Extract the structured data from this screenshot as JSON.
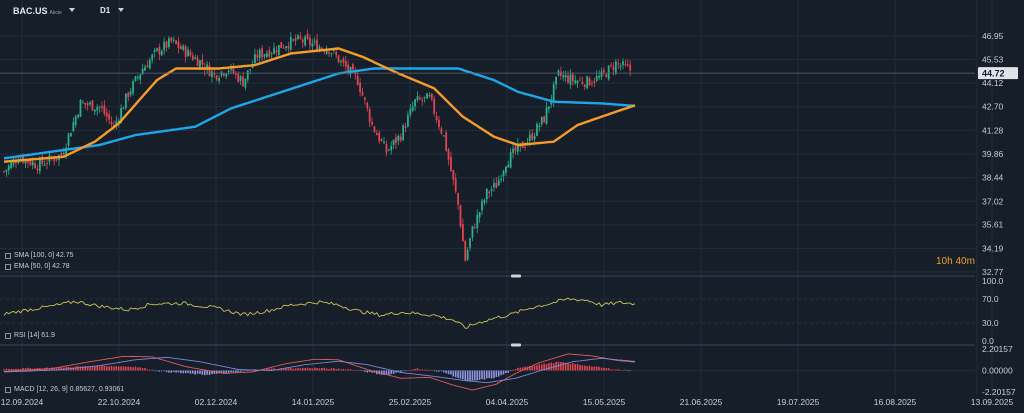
{
  "header": {
    "symbol": "BAC.US",
    "symbol_sub": "Akcie",
    "timeframe": "D1"
  },
  "timer": "10h 40m",
  "legends": {
    "sma": "SMA [100, 0] 42.75",
    "ema": "EMA [50, 0] 42.78",
    "rsi": "RSI [14] 61.9",
    "macd": "MACD [12, 26, 9] 0.85627, 0.93061"
  },
  "colors": {
    "bg": "#161e2a",
    "up": "#27b08a",
    "down": "#e0444f",
    "sma": "#1ea6e8",
    "ema": "#f39c2a",
    "rsi": "#c8c25a",
    "macd_line": "#e35b5b",
    "signal_line": "#7a86d6",
    "hist_pos": "#e0444f",
    "hist_neg": "#8f96e0",
    "grid": "#222c3a",
    "text": "#c8ced8",
    "price_tag_bg": "#dfe3ea"
  },
  "chart_data": [
    {
      "type": "line",
      "name": "price",
      "x_ticks": [
        "12.09.2024",
        "22.10.2024",
        "02.12.2024",
        "14.01.2025",
        "25.02.2025",
        "04.04.2025",
        "15.05.2025",
        "21.06.2025",
        "19.07.2025",
        "16.08.2025",
        "13.09.2025"
      ],
      "y_ticks": [
        "46.95",
        "45.53",
        "44.12",
        "42.70",
        "41.28",
        "39.86",
        "38.44",
        "37.02",
        "35.61",
        "34.19",
        "32.77"
      ],
      "ylim": [
        32.77,
        46.95
      ],
      "current_price": "44.72",
      "current_value": 44.72,
      "candles_approx": {
        "start": "12.09.2024",
        "end": "13.06.2025",
        "anchors": [
          [
            0,
            38.8
          ],
          [
            6,
            39.7
          ],
          [
            14,
            39.2
          ],
          [
            24,
            39.8
          ],
          [
            32,
            42.9
          ],
          [
            40,
            42.7
          ],
          [
            46,
            41.5
          ],
          [
            52,
            43.5
          ],
          [
            58,
            45.0
          ],
          [
            64,
            46.0
          ],
          [
            70,
            46.6
          ],
          [
            76,
            46.0
          ],
          [
            82,
            45.4
          ],
          [
            88,
            44.6
          ],
          [
            94,
            45.0
          ],
          [
            100,
            44.2
          ],
          [
            106,
            45.8
          ],
          [
            112,
            46.1
          ],
          [
            118,
            46.5
          ],
          [
            124,
            46.7
          ],
          [
            130,
            46.4
          ],
          [
            136,
            46.2
          ],
          [
            142,
            45.2
          ],
          [
            148,
            44.3
          ],
          [
            154,
            41.6
          ],
          [
            160,
            40.0
          ],
          [
            166,
            41.0
          ],
          [
            172,
            43.0
          ],
          [
            178,
            43.2
          ],
          [
            184,
            40.9
          ],
          [
            190,
            36.8
          ],
          [
            193,
            33.5
          ],
          [
            196,
            35.3
          ],
          [
            202,
            37.5
          ],
          [
            206,
            38.0
          ],
          [
            210,
            39.4
          ],
          [
            214,
            40.0
          ],
          [
            220,
            40.8
          ],
          [
            226,
            42.0
          ],
          [
            232,
            44.6
          ],
          [
            238,
            44.3
          ],
          [
            244,
            44.2
          ],
          [
            250,
            44.5
          ],
          [
            256,
            45.3
          ],
          [
            262,
            44.9
          ]
        ]
      },
      "series": [
        {
          "name": "SMA [100, 0]",
          "color": "#1ea6e8",
          "points": [
            [
              0,
              39.6
            ],
            [
              40,
              40.4
            ],
            [
              55,
              41.0
            ],
            [
              80,
              41.5
            ],
            [
              95,
              42.6
            ],
            [
              110,
              43.3
            ],
            [
              125,
              44.0
            ],
            [
              140,
              44.7
            ],
            [
              155,
              45.0
            ],
            [
              175,
              45.0
            ],
            [
              190,
              45.0
            ],
            [
              205,
              44.3
            ],
            [
              215,
              43.6
            ],
            [
              230,
              43.0
            ],
            [
              250,
              42.9
            ],
            [
              264,
              42.75
            ]
          ]
        },
        {
          "name": "EMA [50, 0]",
          "color": "#f39c2a",
          "points": [
            [
              0,
              39.4
            ],
            [
              25,
              39.7
            ],
            [
              38,
              40.6
            ],
            [
              48,
              41.7
            ],
            [
              56,
              43.0
            ],
            [
              64,
              44.3
            ],
            [
              72,
              45.0
            ],
            [
              90,
              45.0
            ],
            [
              105,
              45.2
            ],
            [
              120,
              45.9
            ],
            [
              140,
              46.2
            ],
            [
              150,
              45.7
            ],
            [
              165,
              44.7
            ],
            [
              180,
              43.8
            ],
            [
              192,
              42.1
            ],
            [
              205,
              40.9
            ],
            [
              215,
              40.4
            ],
            [
              230,
              40.6
            ],
            [
              240,
              41.6
            ],
            [
              252,
              42.2
            ],
            [
              264,
              42.78
            ]
          ]
        }
      ]
    },
    {
      "type": "line",
      "name": "rsi",
      "y_ticks": [
        "100.0",
        "70.0",
        "30.0",
        "0.0"
      ],
      "ylim": [
        0,
        100
      ],
      "series": [
        {
          "name": "RSI [14]",
          "color": "#c8c25a",
          "points": [
            [
              0,
              45
            ],
            [
              10,
              52
            ],
            [
              20,
              58
            ],
            [
              30,
              66
            ],
            [
              40,
              58
            ],
            [
              52,
              52
            ],
            [
              62,
              62
            ],
            [
              75,
              63
            ],
            [
              90,
              54
            ],
            [
              100,
              44
            ],
            [
              110,
              50
            ],
            [
              120,
              60
            ],
            [
              132,
              65
            ],
            [
              140,
              60
            ],
            [
              148,
              50
            ],
            [
              158,
              43
            ],
            [
              166,
              48
            ],
            [
              172,
              46
            ],
            [
              180,
              43
            ],
            [
              188,
              35
            ],
            [
              193,
              22
            ],
            [
              198,
              30
            ],
            [
              205,
              38
            ],
            [
              212,
              44
            ],
            [
              220,
              55
            ],
            [
              228,
              62
            ],
            [
              236,
              70
            ],
            [
              244,
              68
            ],
            [
              250,
              60
            ],
            [
              258,
              64
            ],
            [
              264,
              61.9
            ]
          ]
        }
      ]
    },
    {
      "type": "bar",
      "name": "macd",
      "y_ticks": [
        "2.20157",
        "0.00000",
        "-2.20157"
      ],
      "ylim": [
        -2.20157,
        2.20157
      ],
      "hist_anchors": [
        [
          0,
          0.3
        ],
        [
          20,
          0.5
        ],
        [
          40,
          0.9
        ],
        [
          55,
          0.7
        ],
        [
          66,
          -0.2
        ],
        [
          84,
          -0.8
        ],
        [
          96,
          -0.4
        ],
        [
          110,
          0.3
        ],
        [
          128,
          0.5
        ],
        [
          146,
          0.2
        ],
        [
          160,
          -0.9
        ],
        [
          172,
          0.4
        ],
        [
          184,
          -0.3
        ],
        [
          194,
          -2.1
        ],
        [
          206,
          -1.3
        ],
        [
          216,
          0.6
        ],
        [
          232,
          1.6
        ],
        [
          244,
          0.9
        ],
        [
          254,
          0.3
        ],
        [
          264,
          -0.08
        ]
      ],
      "series": [
        {
          "name": "MACD [12, 26, 9]",
          "color": "#e35b5b",
          "points": [
            [
              0,
              -0.1
            ],
            [
              20,
              0.2
            ],
            [
              36,
              0.9
            ],
            [
              50,
              1.45
            ],
            [
              62,
              1.4
            ],
            [
              76,
              0.4
            ],
            [
              92,
              -0.3
            ],
            [
              104,
              -0.15
            ],
            [
              118,
              0.7
            ],
            [
              130,
              1.15
            ],
            [
              140,
              1.1
            ],
            [
              152,
              0.1
            ],
            [
              166,
              -0.8
            ],
            [
              178,
              -0.7
            ],
            [
              188,
              -1.5
            ],
            [
              196,
              -2.0
            ],
            [
              206,
              -1.4
            ],
            [
              214,
              -0.3
            ],
            [
              224,
              0.8
            ],
            [
              236,
              1.7
            ],
            [
              246,
              1.5
            ],
            [
              256,
              1.05
            ],
            [
              264,
              0.856
            ]
          ]
        },
        {
          "name": "Signal",
          "color": "#7a86d6",
          "points": [
            [
              0,
              -0.15
            ],
            [
              22,
              0.05
            ],
            [
              40,
              0.5
            ],
            [
              55,
              1.1
            ],
            [
              68,
              1.35
            ],
            [
              82,
              0.9
            ],
            [
              98,
              0.1
            ],
            [
              112,
              0.0
            ],
            [
              126,
              0.6
            ],
            [
              140,
              0.95
            ],
            [
              152,
              0.6
            ],
            [
              166,
              -0.2
            ],
            [
              180,
              -0.6
            ],
            [
              192,
              -1.0
            ],
            [
              202,
              -1.25
            ],
            [
              214,
              -0.8
            ],
            [
              226,
              0.1
            ],
            [
              238,
              0.9
            ],
            [
              250,
              1.25
            ],
            [
              264,
              0.931
            ]
          ]
        }
      ]
    }
  ]
}
